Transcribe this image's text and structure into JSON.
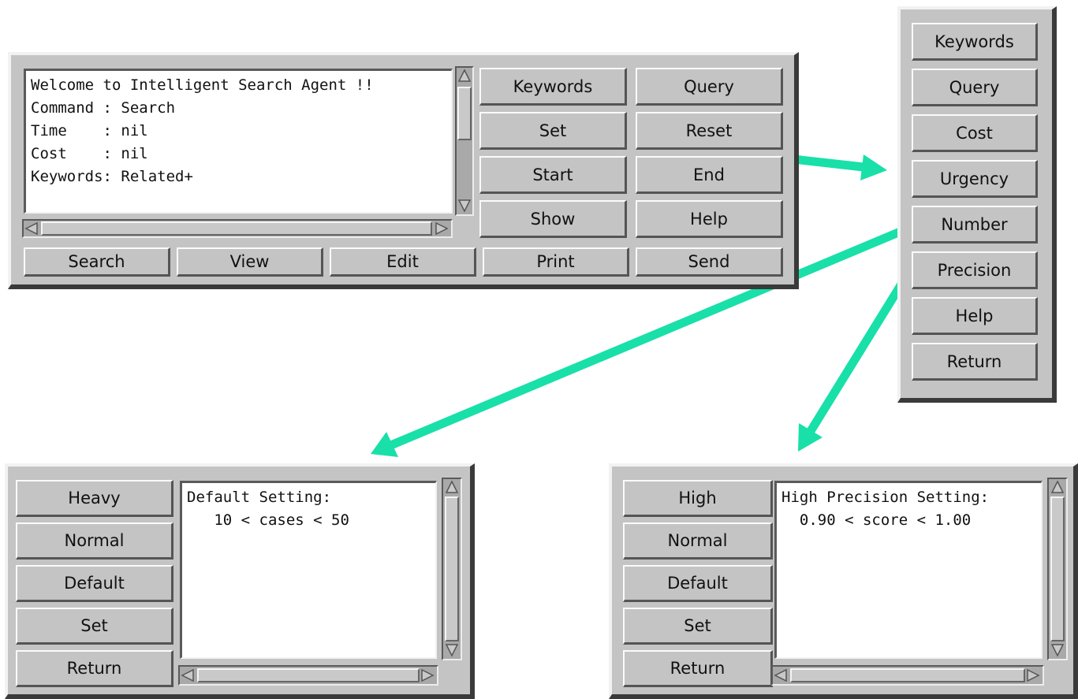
{
  "main_window": {
    "text_lines": [
      "Welcome to Intelligent Search Agent !!",
      "Command : Search",
      "Time    : nil",
      "Cost    : nil",
      "Keywords: Related+"
    ],
    "buttons": {
      "keywords": "Keywords",
      "query": "Query",
      "set": "Set",
      "reset": "Reset",
      "start": "Start",
      "end": "End",
      "show": "Show",
      "help": "Help"
    },
    "bottom_buttons": {
      "search": "Search",
      "view": "View",
      "edit": "Edit",
      "print": "Print",
      "send": "Send"
    }
  },
  "set_menu": {
    "items": [
      "Keywords",
      "Query",
      "Cost",
      "Urgency",
      "Number",
      "Precision",
      "Help",
      "Return"
    ]
  },
  "number_window": {
    "buttons": [
      "Heavy",
      "Normal",
      "Default",
      "Set",
      "Return"
    ],
    "text_lines": [
      "Default Setting:",
      "   10 < cases < 50"
    ]
  },
  "precision_window": {
    "buttons": [
      "High",
      "Normal",
      "Default",
      "Set",
      "Return"
    ],
    "text_lines": [
      "High Precision Setting:",
      "  0.90 < score < 1.00"
    ]
  },
  "colors": {
    "arrow": "#18e0a8",
    "panel": "#c4c4c4"
  }
}
